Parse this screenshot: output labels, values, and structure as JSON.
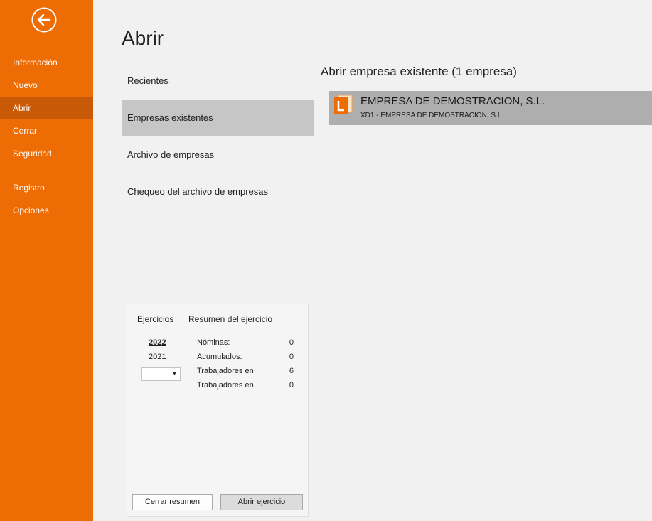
{
  "colors": {
    "sidebar": "#ed6c04",
    "sidebar_active": "#c85906",
    "selected_nav": "#c6c6c6",
    "selected_company": "#aeaeae"
  },
  "sidebar": {
    "back_icon": "arrow-left-circle-icon",
    "items": [
      {
        "label": "Información"
      },
      {
        "label": "Nuevo"
      },
      {
        "label": "Abrir",
        "active": true
      },
      {
        "label": "Cerrar"
      },
      {
        "label": "Seguridad"
      },
      {
        "label": "Registro"
      },
      {
        "label": "Opciones"
      }
    ]
  },
  "page": {
    "title": "Abrir"
  },
  "nav": {
    "items": [
      {
        "label": "Recientes"
      },
      {
        "label": "Empresas existentes",
        "active": true
      },
      {
        "label": "Archivo de empresas"
      },
      {
        "label": "Chequeo del archivo de empresas"
      }
    ]
  },
  "companies": {
    "heading": "Abrir empresa existente  (1 empresa)",
    "list": [
      {
        "name": "EMPRESA DE DEMOSTRACION, S.L.",
        "subtitle": "XD1 - EMPRESA DE DEMOSTRACION, S.L.",
        "icon": "company-file-icon",
        "icon_letter": "L"
      }
    ]
  },
  "ejercicios": {
    "label": "Ejercicios",
    "years": [
      "2022",
      "2021"
    ],
    "selected_year": "2022",
    "combo_value": "",
    "summary_label": "Resumen del ejercicio",
    "stats": [
      {
        "label": "Nóminas:",
        "value": "0"
      },
      {
        "label": "Acumulados:",
        "value": "0"
      },
      {
        "label": "Trabajadores en",
        "value": "6"
      },
      {
        "label": "Trabajadores en",
        "value": "0"
      }
    ],
    "close_button": "Cerrar resumen",
    "open_button": "Abrir ejercicio"
  }
}
